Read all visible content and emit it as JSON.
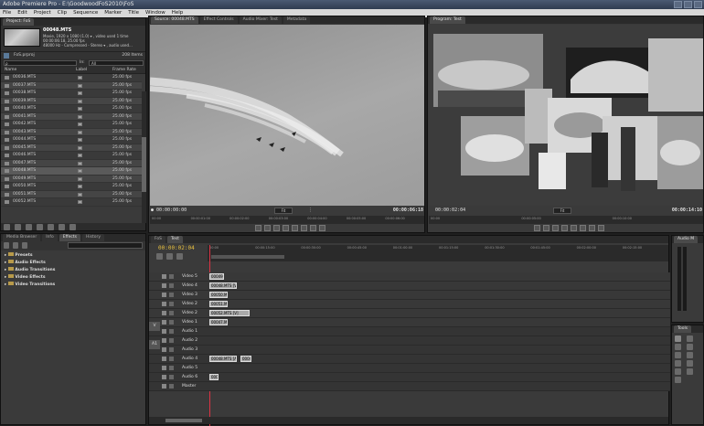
{
  "app": {
    "title": "Adobe Premiere Pro - E:\\GoodwoodFoS2010\\FoS"
  },
  "menu": [
    "File",
    "Edit",
    "Project",
    "Clip",
    "Sequence",
    "Marker",
    "Title",
    "Window",
    "Help"
  ],
  "project": {
    "tab": "Project: FoS",
    "clip_name": "00048.MTS",
    "clip_info1": "Movie, 1920 x 1080 (1.0) ▾ , video used 1 time",
    "clip_info2": "00:00:06:18, 25.00 fps",
    "clip_info3": "48000 Hz - Compressed - Stereo ▾ , audio used...",
    "file": "FoS.prproj",
    "item_count": "208 Items",
    "search_placeholder": "ρ",
    "in_label": "In:",
    "in_value": "All",
    "columns": [
      "Name",
      "Label",
      "Frame Rate"
    ],
    "rows": [
      {
        "name": "00036.MTS",
        "rate": "25.00 fps"
      },
      {
        "name": "00037.MTS",
        "rate": "25.00 fps"
      },
      {
        "name": "00038.MTS",
        "rate": "25.00 fps"
      },
      {
        "name": "00039.MTS",
        "rate": "25.00 fps"
      },
      {
        "name": "00040.MTS",
        "rate": "25.00 fps"
      },
      {
        "name": "00041.MTS",
        "rate": "25.00 fps"
      },
      {
        "name": "00042.MTS",
        "rate": "25.00 fps"
      },
      {
        "name": "00043.MTS",
        "rate": "25.00 fps"
      },
      {
        "name": "00044.MTS",
        "rate": "25.00 fps"
      },
      {
        "name": "00045.MTS",
        "rate": "25.00 fps"
      },
      {
        "name": "00046.MTS",
        "rate": "25.00 fps"
      },
      {
        "name": "00047.MTS",
        "rate": "25.00 fps"
      },
      {
        "name": "00048.MTS",
        "rate": "25.00 fps"
      },
      {
        "name": "00049.MTS",
        "rate": "25.00 fps"
      },
      {
        "name": "00050.MTS",
        "rate": "25.00 fps"
      },
      {
        "name": "00051.MTS",
        "rate": "25.00 fps"
      },
      {
        "name": "00052.MTS",
        "rate": "25.00 fps"
      }
    ]
  },
  "effects": {
    "tabs": [
      "Media Browser",
      "Info",
      "Effects",
      "History"
    ],
    "folders": [
      "Presets",
      "Audio Effects",
      "Audio Transitions",
      "Video Effects",
      "Video Transitions"
    ]
  },
  "source": {
    "tabs": [
      "Source: 00048.MTS",
      "Effect Controls",
      "Audio Mixer: Test",
      "Metadata"
    ],
    "tc_left": "00:00:00:00",
    "fit": "Fit",
    "tc_right": "00:00:06:18",
    "ruler": [
      "00:00",
      "00:00:01:00",
      "00:00:02:00",
      "00:00:03:00",
      "00:00:04:00",
      "00:00:05:00",
      "00:00:06:00"
    ]
  },
  "program": {
    "tab": "Program: Test",
    "tc_left": "00:00:02:04",
    "fit": "Fit",
    "tc_right": "00:00:14:10",
    "ruler": [
      "00:00",
      "00:00:05:00",
      "00:00:10:00"
    ]
  },
  "timeline": {
    "tabs": [
      "FoS",
      "Test"
    ],
    "timecode": "00:00:02:04",
    "ruler": [
      "00:00",
      "00:00:15:00",
      "00:00:30:00",
      "00:00:45:00",
      "00:01:00:00",
      "00:01:15:00",
      "00:01:30:00",
      "00:01:45:00",
      "00:02:00:00",
      "00:02:15:00"
    ],
    "tracks": [
      {
        "name": "Video 5",
        "clip": "00049.MTS"
      },
      {
        "name": "Video 4",
        "clip": "00048.MTS [V]"
      },
      {
        "name": "Video 3",
        "clip": "00050.MTS"
      },
      {
        "name": "Video 2",
        "clip": "00051.MTS"
      },
      {
        "name": "Video 2",
        "clip": "00052.MTS [V]"
      },
      {
        "name": "Video 1",
        "clip": "00047.MT"
      },
      {
        "name": "Audio 1",
        "clip": ""
      },
      {
        "name": "Audio 2",
        "clip": ""
      },
      {
        "name": "Audio 3",
        "clip": ""
      },
      {
        "name": "Audio 4",
        "clip": "00048.MTS [A]"
      },
      {
        "name": "Audio 5",
        "clip": ""
      },
      {
        "name": "Audio 6",
        "clip": "00049"
      },
      {
        "name": "Master",
        "clip": ""
      }
    ],
    "audio4_extra": "00049",
    "v_label": "V",
    "a_label": "A1"
  },
  "audio_meter": {
    "tab": "Audio M"
  },
  "tools": {
    "tab": "Tools"
  }
}
